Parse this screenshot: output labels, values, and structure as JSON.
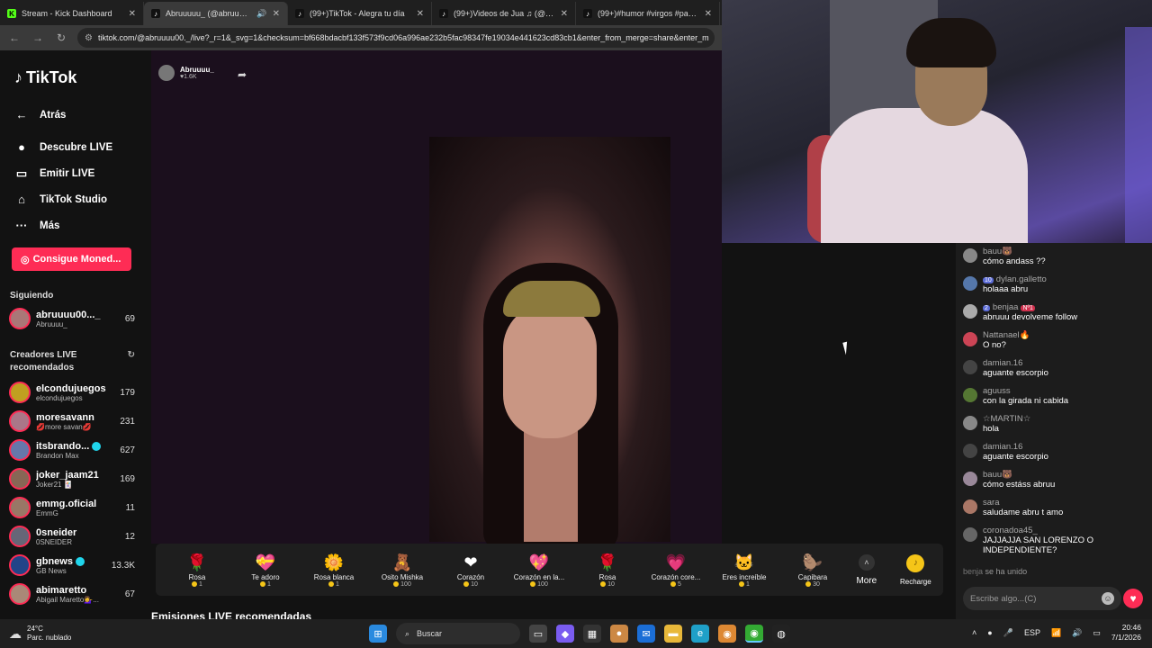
{
  "browser": {
    "tabs": [
      {
        "title": "Stream - Kick Dashboard",
        "fav": "K",
        "fav_color": "#53fc18"
      },
      {
        "title": "Abruuuuu_ (@abruuuu00...",
        "fav": "♪",
        "fav_color": "#111111",
        "sound": "🔊"
      },
      {
        "title": "(99+)TikTok - Alegra tu día",
        "fav": "♪",
        "fav_color": "#111111"
      },
      {
        "title": "(99+)Videos de Jua ♫ (@j.u.a.n",
        "fav": "♪",
        "fav_color": "#111111"
      },
      {
        "title": "(99+)#humor #virgos #paratiiii",
        "fav": "♪",
        "fav_color": "#111111"
      }
    ],
    "url": "tiktok.com/@abruuuu00._/live?_r=1&_svg=1&checksum=bf668bdacbf133f573f9cd06a996ae232b5fac98347fe19034e441623cd83cb1&enter_from_merge=share&enter_m"
  },
  "sidebar": {
    "logo": "TikTok",
    "nav": [
      {
        "icon": "←",
        "label": "Atrás"
      },
      {
        "icon": "●",
        "label": "Descubre LIVE"
      },
      {
        "icon": "▭",
        "label": "Emitir LIVE"
      },
      {
        "icon": "⌂",
        "label": "TikTok Studio"
      },
      {
        "icon": "···",
        "label": "Más"
      }
    ],
    "coins_button": "Consigue Moned...",
    "following_title": "Siguiendo",
    "following": [
      {
        "name": "abruuuu00..._",
        "sub": "Abruuuu_",
        "count": "69"
      }
    ],
    "recommended_title": "Creadores LIVE recomendados",
    "recommended": [
      {
        "name": "elcondujuegos",
        "sub": "elcondujuegos",
        "count": "179",
        "color": "#c0a020"
      },
      {
        "name": "moresavann",
        "sub": "💋more savan💋",
        "count": "231",
        "color": "#aa7788"
      },
      {
        "name": "itsbrando...",
        "sub": "Brandon Max",
        "count": "627",
        "color": "#6677aa",
        "verified": true
      },
      {
        "name": "joker_jaam21",
        "sub": "Joker21 🃏",
        "count": "169",
        "color": "#886655"
      },
      {
        "name": "emmg.oficial",
        "sub": "EmmG",
        "count": "11",
        "color": "#997766"
      },
      {
        "name": "0sneider",
        "sub": "0SNEIDER",
        "count": "12",
        "color": "#666677"
      },
      {
        "name": "gbnews",
        "sub": "GB News",
        "count": "13.3K",
        "color": "#224488",
        "verified": true
      },
      {
        "name": "abimaretto",
        "sub": "Abigail Maretto💁‍♀️...",
        "count": "67",
        "color": "#aa8877"
      }
    ]
  },
  "stage": {
    "host_name": "Abruuuu_",
    "host_likes": "♥1.6K"
  },
  "gifts": [
    {
      "icon": "🌹",
      "label": "Rosa",
      "price": "1"
    },
    {
      "icon": "💝",
      "label": "Te adoro",
      "price": "1"
    },
    {
      "icon": "🌼",
      "label": "Rosa blanca",
      "price": "1"
    },
    {
      "icon": "🧸",
      "label": "Osito Mishka",
      "price": "100"
    },
    {
      "icon": "❤",
      "label": "Corazón",
      "price": "10"
    },
    {
      "icon": "💖",
      "label": "Corazón en la...",
      "price": "100"
    },
    {
      "icon": "🌹",
      "label": "Rosa",
      "price": "10"
    },
    {
      "icon": "💗",
      "label": "Corazón core...",
      "price": "5"
    },
    {
      "icon": "🐱",
      "label": "Eres increíble",
      "price": "1"
    },
    {
      "icon": "🦫",
      "label": "Capibara",
      "price": "30"
    }
  ],
  "more_label": "More",
  "recharge_label": "Recharge",
  "bottom_title": "Emisiones LIVE recomendadas",
  "chat": {
    "messages": [
      {
        "user": "bauu🐻",
        "text": "cómo andass ??",
        "color": "#888888"
      },
      {
        "user": "dylan.galletto",
        "badge": "10",
        "text": "holaaa abru",
        "color": "#5577aa"
      },
      {
        "user": "benjaa",
        "badge": "2",
        "badge2": "Nº1",
        "text": "abruuu devolveme follow",
        "color": "#aaaaaa"
      },
      {
        "user": "Nattanael🔥",
        "text": "O no?",
        "color": "#cc4455"
      },
      {
        "user": "damian.16",
        "text": "aguante escorpio",
        "color": "#444444"
      },
      {
        "user": "aguuss",
        "text": "con la girada ni cabida",
        "color": "#557733"
      },
      {
        "user": "☆MARTIN☆",
        "text": "hola",
        "color": "#888888"
      },
      {
        "user": "damian.16",
        "text": "aguante escorpio",
        "color": "#444444"
      },
      {
        "user": "bauu🐻",
        "text": "cómo estáss abruu",
        "color": "#998899"
      },
      {
        "user": "sara",
        "text": "saludame abru t amo",
        "color": "#aa7766"
      },
      {
        "user": "coronadoa45_",
        "text": "JAJJAJJA SAN LORENZO O INDEPENDIENTE?",
        "color": "#666666",
        "tall": true
      }
    ],
    "joined_user": "benja",
    "joined_text": "se ha unido",
    "input_placeholder": "Escribe algo...(C)"
  },
  "taskbar": {
    "temp": "24°C",
    "condition": "Parc. nublado",
    "search_label": "Buscar",
    "lang": "ESP",
    "time": "20:46",
    "date": "7/1/2026"
  }
}
